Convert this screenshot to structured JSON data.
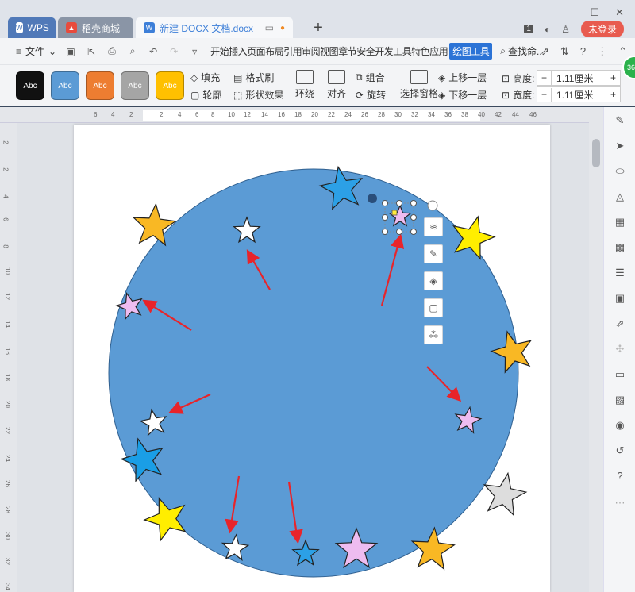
{
  "tabs": {
    "wps": "WPS",
    "store": "稻壳商城",
    "doc": "新建 DOCX 文档.docx",
    "add": "+"
  },
  "titlebar": {
    "badge": "1",
    "login": "未登录",
    "minimize": "—",
    "maximize": "☐",
    "close": "✕"
  },
  "menubar": {
    "file": "文件",
    "menus": [
      "开始",
      "插入",
      "页面布局",
      "引用",
      "审阅",
      "视图",
      "章节",
      "安全",
      "开发工具",
      "特色应用"
    ],
    "active": "绘图工具",
    "search": "查找命..."
  },
  "ribbon": {
    "styles": [
      {
        "label": "Abc",
        "color": "#111111"
      },
      {
        "label": "Abc",
        "color": "#5b9bd5"
      },
      {
        "label": "Abc",
        "color": "#ed7d31"
      },
      {
        "label": "Abc",
        "color": "#a5a5a5"
      },
      {
        "label": "Abc",
        "color": "#ffc000"
      }
    ],
    "fill": "填充",
    "format_brush": "格式刷",
    "outline": "轮廓",
    "shape_effect": "形状效果",
    "wrap": "环绕",
    "align": "对齐",
    "group": "组合",
    "rotate": "旋转",
    "select_pane": "选择窗格",
    "bring_forward": "上移一层",
    "send_backward": "下移一层",
    "height_label": "高度:",
    "height_value": "1.11厘米",
    "width_label": "宽度:",
    "width_value": "1.11厘米",
    "minus": "−",
    "plus": "+",
    "green_badge": "36"
  },
  "ruler": {
    "h_ticks": [
      "6",
      "4",
      "2",
      "2",
      "4",
      "6",
      "8",
      "10",
      "12",
      "14",
      "16",
      "18",
      "20",
      "22",
      "24",
      "26",
      "28",
      "30",
      "32",
      "34",
      "36",
      "38",
      "40",
      "42",
      "44",
      "46"
    ],
    "v_ticks": [
      "2",
      "2",
      "4",
      "6",
      "8",
      "10",
      "12",
      "14",
      "16",
      "18",
      "20",
      "22",
      "24",
      "26",
      "28",
      "30",
      "32",
      "34"
    ]
  },
  "colors": {
    "circle": "#5b9bd5",
    "arrow": "#e8242a",
    "accent": "#2b73d6"
  }
}
